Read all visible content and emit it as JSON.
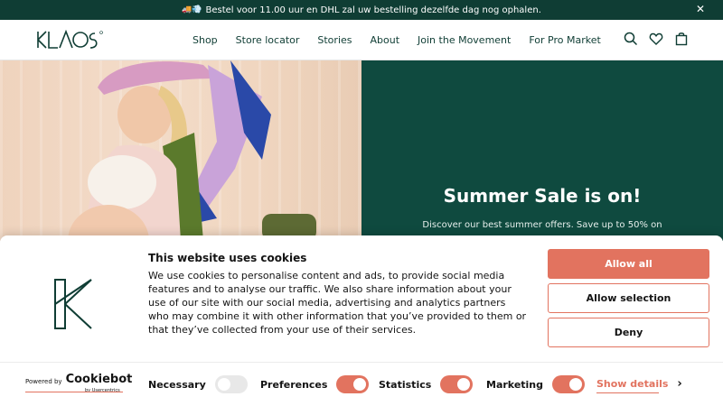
{
  "announcement": {
    "emoji": "🚚💨",
    "text": "Bestel voor 11.00 uur en DHL zal uw bestelling dezelfde dag nog ophalen.",
    "close": "✕"
  },
  "header": {
    "logo_text": "KLAOS",
    "nav": [
      "Shop",
      "Store locator",
      "Stories",
      "About",
      "Join the Movement",
      "For Pro Market"
    ],
    "icons": [
      "search-icon",
      "heart-icon",
      "bag-icon"
    ]
  },
  "hero": {
    "title": "Summer Sale is on!",
    "subtitle": "Discover our best summer offers. Save up to 50% on"
  },
  "cookie": {
    "title": "This website uses cookies",
    "text": "We use cookies to personalise content and ads, to provide social media features and to analyse our traffic. We also share information about your use of our site with our social media, advertising and analytics partners who may combine it with other information that you’ve provided to them or that they’ve collected from your use of their services.",
    "buttons": {
      "allow_all": "Allow all",
      "allow_selection": "Allow selection",
      "deny": "Deny"
    },
    "powered": {
      "powered_by": "Powered by",
      "brand": "Cookiebot",
      "by": "by Usercentrics"
    },
    "toggles": [
      {
        "label": "Necessary",
        "on": false
      },
      {
        "label": "Preferences",
        "on": true
      },
      {
        "label": "Statistics",
        "on": true
      },
      {
        "label": "Marketing",
        "on": true
      }
    ],
    "show_details": "Show details"
  },
  "colors": {
    "brand_green": "#0f3d34",
    "accent": "#e2735f"
  }
}
